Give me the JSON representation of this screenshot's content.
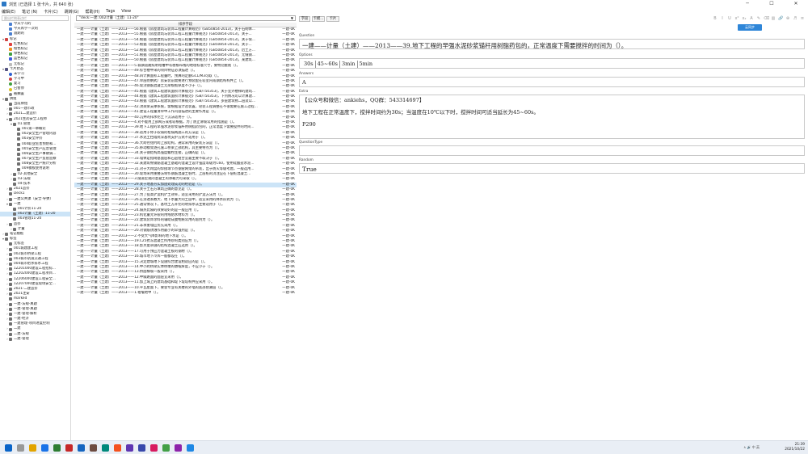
{
  "window": {
    "title": "浏览 (已选择 1 张卡片，共 640 张)",
    "controls": [
      "─",
      "☐",
      "✕"
    ]
  },
  "menu": [
    "编辑(E)",
    "笔记 (N)",
    "卡片(C)",
    "跳转(G)",
    "帮助(H)",
    "Tags",
    "View"
  ],
  "sidebar": {
    "search_placeholder": "跟出栏侧表边栏",
    "items": [
      {
        "label": "今天学习的",
        "indent": 1,
        "icon": "clock-icon",
        "color": "#4a7fd0"
      },
      {
        "label": "今天再学一次的",
        "indent": 1,
        "icon": "clock-icon",
        "color": "#4a7fd0"
      },
      {
        "label": "逾期的",
        "indent": 1,
        "icon": "clock-icon",
        "color": "#4a7fd0"
      },
      {
        "label": "标记",
        "indent": 0,
        "icon": "flag-icon",
        "color": "#d04040",
        "tw": "▾"
      },
      {
        "label": "红色标记",
        "indent": 1,
        "icon": "flag-icon",
        "color": "#e04040"
      },
      {
        "label": "橙色标记",
        "indent": 1,
        "icon": "flag-icon",
        "color": "#f09020"
      },
      {
        "label": "绿色标记",
        "indent": 1,
        "icon": "flag-icon",
        "color": "#40a040"
      },
      {
        "label": "蓝色标记",
        "indent": 1,
        "icon": "flag-icon",
        "color": "#4060e0"
      },
      {
        "label": "无标记",
        "indent": 1,
        "icon": "flag-icon",
        "color": "#bbbbbb"
      },
      {
        "label": "卡片状态",
        "indent": 0,
        "icon": "cards-icon",
        "color": "#505080",
        "tw": "▾"
      },
      {
        "label": "未学习",
        "indent": 1,
        "icon": "dot-icon",
        "color": "#3060d0"
      },
      {
        "label": "学习中",
        "indent": 1,
        "icon": "dot-icon",
        "color": "#d04040"
      },
      {
        "label": "复习",
        "indent": 1,
        "icon": "dot-icon",
        "color": "#40a040"
      },
      {
        "label": "已暂停",
        "indent": 1,
        "icon": "dot-icon",
        "color": "#e0c020"
      },
      {
        "label": "被搁置",
        "indent": 1,
        "icon": "dot-icon",
        "color": "#808080"
      },
      {
        "label": "牌组",
        "indent": 0,
        "icon": "deck-icon",
        "color": "#707070",
        "tw": "▾"
      },
      {
        "label": "当前牌组",
        "indent": 1,
        "icon": "deck-icon",
        "color": "#707070"
      },
      {
        "label": "001一建市政",
        "indent": 1,
        "icon": "deck-icon",
        "color": "#707070",
        "tw": "›"
      },
      {
        "label": "2021二建造价",
        "indent": 1,
        "icon": "deck-icon",
        "color": "#707070",
        "tw": "›"
      },
      {
        "label": "2021生药安全工程师",
        "indent": 1,
        "icon": "deck-icon",
        "color": "#707070",
        "tw": "▾"
      },
      {
        "label": "01.管理",
        "indent": 2,
        "icon": "deck-icon",
        "color": "#707070",
        "tw": "▾"
      },
      {
        "label": "001第一章概论",
        "indent": 3,
        "icon": "deck-icon",
        "color": "#707070"
      },
      {
        "label": "002安全生产管理内容",
        "indent": 3,
        "icon": "deck-icon",
        "color": "#707070"
      },
      {
        "label": "003安全评价",
        "indent": 3,
        "icon": "deck-icon",
        "color": "#707070"
      },
      {
        "label": "004职业危害预防和...",
        "indent": 3,
        "icon": "deck-icon",
        "color": "#707070"
      },
      {
        "label": "005安全生产应急管理",
        "indent": 3,
        "icon": "deck-icon",
        "color": "#707070"
      },
      {
        "label": "006安全生产事故调...",
        "indent": 3,
        "icon": "deck-icon",
        "color": "#707070"
      },
      {
        "label": "007安全生产监管监察",
        "indent": 3,
        "icon": "deck-icon",
        "color": "#707070"
      },
      {
        "label": "008安全生产统计分析",
        "indent": 3,
        "icon": "deck-icon",
        "color": "#707070"
      },
      {
        "label": "009模板使用说明",
        "indent": 3,
        "icon": "deck-icon",
        "color": "#707070"
      },
      {
        "label": "02-其他安全",
        "indent": 2,
        "icon": "deck-icon",
        "color": "#707070",
        "tw": "›"
      },
      {
        "label": "03-法规",
        "indent": 2,
        "icon": "deck-icon",
        "color": "#707070",
        "tw": "›"
      },
      {
        "label": "04-技术",
        "indent": 2,
        "icon": "deck-icon",
        "color": "#707070"
      },
      {
        "label": "2021造价",
        "indent": 1,
        "icon": "deck-icon",
        "color": "#707070",
        "tw": "›"
      },
      {
        "label": "Deck1",
        "indent": 1,
        "icon": "deck-icon",
        "color": "#707070"
      },
      {
        "label": "一建公共课（安全·导弹）",
        "indent": 1,
        "icon": "deck-icon",
        "color": "#707070",
        "tw": "›"
      },
      {
        "label": "一建",
        "indent": 1,
        "icon": "deck-icon",
        "color": "#707070",
        "tw": "▾"
      },
      {
        "label": "001计价11-20",
        "indent": 2,
        "icon": "deck-icon",
        "color": "#707070"
      },
      {
        "label": "002计量（土建）11-20",
        "indent": 2,
        "icon": "deck-icon",
        "color": "#707070",
        "sel": true
      },
      {
        "label": "003管理11-20",
        "indent": 2,
        "icon": "deck-icon",
        "color": "#707070"
      },
      {
        "label": "造价",
        "indent": 1,
        "icon": "deck-icon",
        "color": "#707070",
        "tw": "›"
      },
      {
        "label": "计量",
        "indent": 2,
        "icon": "deck-icon",
        "color": "#707070",
        "tw": "›"
      },
      {
        "label": "笔记模板",
        "indent": 0,
        "icon": "template-icon",
        "color": "#707070",
        "tw": "›"
      },
      {
        "label": "标签",
        "indent": 0,
        "icon": "tag-icon",
        "color": "#707070",
        "tw": "▾"
      },
      {
        "label": "无标签",
        "indent": 1,
        "icon": "tag-icon",
        "color": "#707070"
      },
      {
        "label": "001城建建工程",
        "indent": 1,
        "icon": "tag-icon",
        "color": "#707070",
        "tw": "›"
      },
      {
        "label": "002城市桥梁工程",
        "indent": 1,
        "icon": "tag-icon",
        "color": "#707070",
        "tw": "›"
      },
      {
        "label": "003城市轨道交通工程",
        "indent": 1,
        "icon": "tag-icon",
        "color": "#707070",
        "tw": "›"
      },
      {
        "label": "004城市给水排水工程",
        "indent": 1,
        "icon": "tag-icon",
        "color": "#707070",
        "tw": "›"
      },
      {
        "label": "1Z201000建设工程招标...",
        "indent": 1,
        "icon": "tag-icon",
        "color": "#707070",
        "tw": "›"
      },
      {
        "label": "1Z202000建设工程项目...",
        "indent": 1,
        "icon": "tag-icon",
        "color": "#707070",
        "tw": "›"
      },
      {
        "label": "1Z206000建设工程安全...",
        "indent": 1,
        "icon": "tag-icon",
        "color": "#707070",
        "tw": "›"
      },
      {
        "label": "1Z207000建设现场安全...",
        "indent": 1,
        "icon": "tag-icon",
        "color": "#707070",
        "tw": "›"
      },
      {
        "label": "2021-二建造价",
        "indent": 1,
        "icon": "tag-icon",
        "color": "#707070",
        "tw": "›"
      },
      {
        "label": "2021注安",
        "indent": 1,
        "icon": "tag-icon",
        "color": "#707070",
        "tw": "›"
      },
      {
        "label": "marked",
        "indent": 1,
        "icon": "tag-icon",
        "color": "#707070"
      },
      {
        "label": "一建-法规-真题",
        "indent": 1,
        "icon": "tag-icon",
        "color": "#707070",
        "tw": "›"
      },
      {
        "label": "一建-管理-真题",
        "indent": 1,
        "icon": "tag-icon",
        "color": "#707070",
        "tw": "›"
      },
      {
        "label": "一建-管理-解析",
        "indent": 1,
        "icon": "tag-icon",
        "color": "#707070",
        "tw": "›"
      },
      {
        "label": "一建-经济",
        "indent": 1,
        "icon": "tag-icon",
        "color": "#707070",
        "tw": "›"
      },
      {
        "label": "一建管理-项目进度控制",
        "indent": 1,
        "icon": "tag-icon",
        "color": "#707070"
      },
      {
        "label": "二建",
        "indent": 1,
        "icon": "tag-icon",
        "color": "#707070",
        "tw": "›"
      },
      {
        "label": "二建-法规",
        "indent": 1,
        "icon": "tag-icon",
        "color": "#707070",
        "tw": "›"
      },
      {
        "label": "二建-管理",
        "indent": 1,
        "icon": "tag-icon",
        "color": "#707070",
        "tw": "›"
      }
    ]
  },
  "browser": {
    "deck_query": "\"deck:一建::002计量（土建）11-20\"",
    "column_header": "排序字段",
    "selected_row_index": 30,
    "rows": [
      {
        "q": "一建——计量（土建）——2013——56.根据《房屋建筑与装饰工程量计算规范》(GB50854-2013)，关于石砌体...",
        "d": "一建-0K"
      },
      {
        "q": "一建——计量（土建）——2013——55.根据《房屋建筑与装饰工程工程量计算规范》(GB50854-2013)，关于...",
        "d": "一建-0K"
      },
      {
        "q": "一建——计量（土建）——2013——54.根据《房屋建筑与装饰工程工程量计算规范》(GB50854-2013)，关于保...",
        "d": "一建-0K"
      },
      {
        "q": "一建——计量（土建）——2013——53.根据《房屋建筑与装饰工程工程量计算规范》(GB50854-2013)，关于...",
        "d": "一建-0K"
      },
      {
        "q": "一建——计量（土建）——2013——52.根据《房屋建筑与装饰工程工程量计算规范》(GB50854-2013)，后土方...",
        "d": "一建-0K"
      },
      {
        "q": "一建——计量（土建）——2013——51.根据《房屋建筑与装饰工程工程量计算规范》(GB50854-2013)，无缝钢...",
        "d": "一建-0K"
      },
      {
        "q": "一建——计量（土建）——2013——50.根据《房屋建筑与装饰工程工程量计算规范》(GB50854-2013)，某建筑...",
        "d": "一建-0K"
      },
      {
        "q": "一建——计量（土建）——2013——5.城镇道路照明暗槽中有德根布线的地理标准尺寸，要特别重视（）。",
        "d": "一建-0K"
      },
      {
        "q": "一建——计量（土建）——2013——49.综合楼中采的项目特征必须描述（）。",
        "d": "一建-0K"
      },
      {
        "q": "一建——计量（土建）——2013——48.四计算面积工程量时，预算的定额GCL/M3可取（）。",
        "d": "一建-0K"
      },
      {
        "q": "一建——计量（土建）——2013——47.单层防纳式厂房安装前需要进行预装配在较室内或钢结构构件上（）。",
        "d": "一建-0K"
      },
      {
        "q": "一建——计量（土建）——2013——46.现浇钢筋混凝土无梁板板厚度不小于（）。",
        "d": "一建-0K"
      },
      {
        "q": "一建——计量（土建）——2013——45.根据《建筑工程建筑面积计算规范》(GB/T50353)，关于室外楼梯的建筑...",
        "d": "一建-0K"
      },
      {
        "q": "一建——计量（土建）——2013——44.根据《建筑工程建筑面积计算规范》(GB/T50353)，下列情况可以计算建...",
        "d": "一建-0K"
      },
      {
        "q": "一建——计量（土建）——2013——43.根据《建筑工程建筑面积计算规范》(GB/T50353)，多层建筑物二层及以...",
        "d": "一建-0K"
      },
      {
        "q": "一建——计量（土建）——2013——42.顶梁梁支撑系统，需根据设计及装置，轻装工程调整在不很需要在施工过程...",
        "d": "一建-0K"
      },
      {
        "q": "一建——计量（土建）——2013——41.建设工程量清单中工作内容描述的主要作用是（）。",
        "d": "一建-0K"
      },
      {
        "q": "一建——计量（土建）——2013——40.沉井的排水挖土下沉法适用于（）。",
        "d": "一建-0K"
      },
      {
        "q": "一建——计量（土建）——2013——4.对不能用上部网方或者较根据，为了防止滑坡常用的措施是（）。",
        "d": "一建-0K"
      },
      {
        "q": "一建——计量（土建）——2013——39.地下工程的早强水泥砂浆锚杆用树脂药包的，正常温度下需要搅拌的时间...",
        "d": "一建-0K"
      },
      {
        "q": "一建——计量（土建）——2013——38.适用于修于软弱的松隔两施工的方法是（）。",
        "d": "一建-0K"
      },
      {
        "q": "一建——计量（土建）——2013——37.水泥土挡墙式深基坑支护方式不适用于（）。",
        "d": "一建-0K"
      },
      {
        "q": "一建——计量（土建）——2013——36.大跨径组约跨上部结构，通常采用的安装方法是（）。",
        "d": "一建-0K"
      },
      {
        "q": "一建——计量（土建）——2013——35.移动模架逐孔施工桥梁上部结构，其主要特点为（）。",
        "d": "一建-0K"
      },
      {
        "q": "一建——计量（土建）——2013——34.关于钢结构高强度螺栓连接，正确的是（）。",
        "d": "一建-0K"
      },
      {
        "q": "一建——计量（土建）——2013——33.墙体是指砌基面层和石层组合宜最主要不取决于（）。",
        "d": "一建-0K"
      },
      {
        "q": "一建——计量（土建）——2013——32.某建筑物钢筋混凝土基础的混凝土设计强度等级为C60，使用硅酸盐水泥...",
        "d": "一建-0K"
      },
      {
        "q": "一建——计量（土建）——2013——31.对于大跨度的焊接球节点钢管网架的吊装，出于防火等级考虑，一般选用...",
        "d": "一建-0K"
      },
      {
        "q": "一建——计量（土建）——2013——30.现场采用重叠法制作钢筋混凝土桩时，上层桩的浇注应在下层桩混凝土...",
        "d": "一建-0K"
      },
      {
        "q": "一建——计量（土建）——2013——3.隧道宏观的混凝土的承载力可采取（）。",
        "d": "一建-0K"
      },
      {
        "q": "一建——计量（土建）——2013——29.关于地基夯实加固处理成功的经验是（）。",
        "d": "一建-0K"
      },
      {
        "q": "一建——计量（土建）——2013——28.关于土石方填筑正确的意见是（）。",
        "d": "一建-0K"
      },
      {
        "q": "一建——计量（土建）——2013——27.为了提高铲运机铲土效率，适宜采用的铲运方法为（）。",
        "d": "一建-0K"
      },
      {
        "q": "一建——计量（土建）——2013——26.在渗透系数大、地下水量大的土层中，适宜采用的降水形式为（）。",
        "d": "一建-0K"
      },
      {
        "q": "一建——计量（土建）——2013——25.通常情况下，基坑土方开挖的明排水法主要适用于（）。",
        "d": "一建-0K"
      },
      {
        "q": "一建——计量（土建）——2013——24.隔热比隔的效果较好的是一般应用（）。",
        "d": "一建-0K"
      },
      {
        "q": "一建——计量（土建）——2013——23.机化量允许裂的用线防水材料为（）。",
        "d": "一建-0K"
      },
      {
        "q": "一建——计量（土建）——2013——22.建筑装饰涂料的辅助成膜物质常用的溶剂为（）。",
        "d": "一建-0K"
      },
      {
        "q": "一建——计量（土建）——2013——21.非承重墙应优先采用（）。",
        "d": "一建-0K"
      },
      {
        "q": "一建——计量（土建）——2013——20.对钢筋锈蚀作用最小的早强剂是（）。",
        "d": "一建-0K"
      },
      {
        "q": "一建——计量（土建）——2013——2.不受大气降影响的地下水是（）。",
        "d": "一建-0K"
      },
      {
        "q": "一建——计量（土建）——2013——19.C25抗冻混凝土所用砂的类别应为（）。",
        "d": "一建-0K"
      },
      {
        "q": "一建——计量（土建）——2013——18.影点复杂施的结构混凝土应选用（）。",
        "d": "一建-0K"
      },
      {
        "q": "一建——计量（土建）——2013——17.可用于预应力混凝土板的钢材（）。",
        "d": "一建-0K"
      },
      {
        "q": "一建——计量（土建）——2013——16.城市地下冷库一般都设在（）。",
        "d": "一建-0K"
      },
      {
        "q": "一建——计量（土建）——2013——15.决定建城地下设施综合建设相适应的是（）。",
        "d": "一建-0K"
      },
      {
        "q": "一建——计量（土建）——2013——14.中小跨桥梁实体桥墩的墩帽厚度，不应小于（）。",
        "d": "一建-0K"
      },
      {
        "q": "一建——计量（土建）——2013——13.桥面横坡一般采用（）。",
        "d": "一建-0K"
      },
      {
        "q": "一建——计量（土建）——2013——12.中级路面的面层宜采用（）。",
        "d": "一建-0K"
      },
      {
        "q": "一建——计量（土建）——2013——11.加上域上的建筑基础和堤下堤塔构件应采用（）。",
        "d": "一建-0K"
      },
      {
        "q": "一建——计量（土建）——2013——10.平瓦屋面下，要会专业有关楼的外墙的底部防潮层（）。",
        "d": "一建-0K"
      },
      {
        "q": "一建——计量（土建）——2013——1.褶皱地中（）。",
        "d": "一建-0K"
      }
    ]
  },
  "editor": {
    "buttons": {
      "fields": "字段",
      "cards": "卡模...",
      "tags": "卡片"
    },
    "format_icons": [
      "B",
      "I",
      "U",
      "x²",
      "x₂",
      "A",
      "✎",
      "⌫",
      "▥",
      "🔗",
      "⊕",
      "♬",
      "≡"
    ],
    "sync_label": "云同步",
    "fields": {
      "question_label": "Question",
      "question_value": "一建——计量（土建）——2013——39.地下工程的早强水泥砂浆锚杆用树脂药包的，正常温度下需要搅拌的时间为（）。",
      "options_label": "Options",
      "options": [
        "30s",
        "45~60s",
        "3min",
        "5min"
      ],
      "answers_label": "Answers",
      "answers_value": "A",
      "extra_label": "Extra",
      "extra_lines": [
        "【公众号和微信：ankiehs，QQ群：543314697】",
        "地下工程在正常温度下，搅拌时间约为30s；当温度在10℃以下时，搅拌时间可适当延长为45~60s。",
        "P290"
      ],
      "qtype_label": "QuestionType",
      "qtype_value": "",
      "random_label": "Random",
      "random_value": "True"
    }
  },
  "taskbar": {
    "time": "21:39",
    "date": "2021/10/22",
    "tray": "∧ 🔊 中 英"
  }
}
